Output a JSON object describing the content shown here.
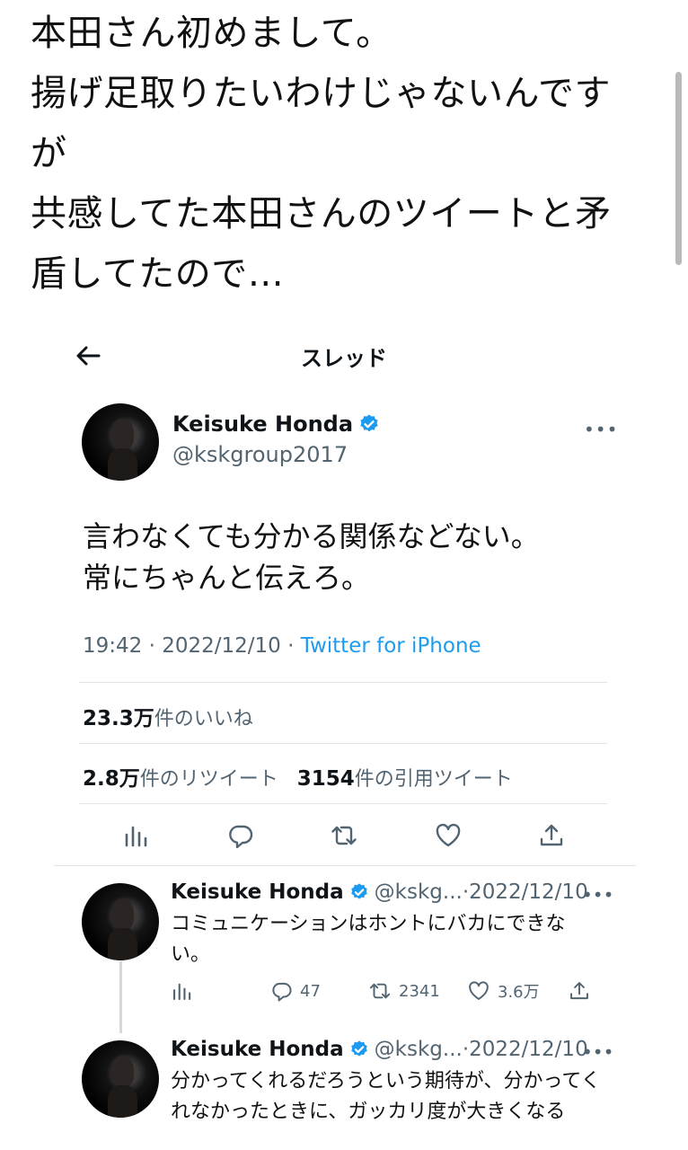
{
  "caption": {
    "lines": [
      "本田さん初めまして。",
      "揚げ足取りたいわけじゃないんです",
      "が",
      "共感してた本田さんのツイートと矛",
      "盾してたので…"
    ]
  },
  "header": {
    "title": "スレッド",
    "back_icon": "back-arrow-icon"
  },
  "main_tweet": {
    "name": "Keisuke Honda",
    "handle": "@kskgroup2017",
    "text_lines": [
      "言わなくても分かる関係などない。",
      "常にちゃんと伝えろ。"
    ],
    "time": "19:42 · 2022/12/10 · ",
    "source": "Twitter for iPhone",
    "likes_count": "23.3万",
    "likes_label": "件のいいね",
    "retweets_count": "2.8万",
    "retweets_label": "件のリツイート",
    "quotes_count": "3154",
    "quotes_label": "件の引用ツイート"
  },
  "replies": [
    {
      "name": "Keisuke Honda",
      "handle_date": "@kskg...·2022/12/10",
      "text": "コミュニケーションはホントにバカにできない。",
      "replies_count": "47",
      "retweets_count": "2341",
      "likes_count": "3.6万"
    },
    {
      "name": "Keisuke Honda",
      "handle_date": "@kskg...·2022/12/10",
      "text": "分かってくれるだろうという期待が、分かってくれなかったときに、ガッカリ度が大きくなる"
    }
  ],
  "colors": {
    "accent": "#1d9bf0",
    "secondary_text": "#536471",
    "divider": "#dfe3e6"
  }
}
